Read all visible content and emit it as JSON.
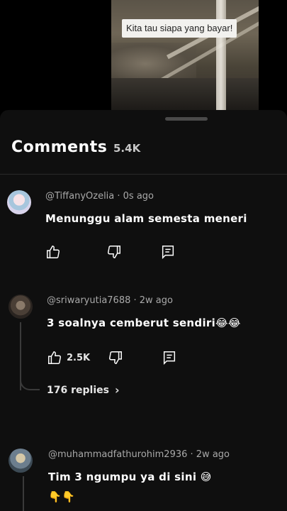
{
  "video": {
    "caption": "Kita tau siapa yang bayar!"
  },
  "sheet": {
    "title": "Comments",
    "count": "5.4K"
  },
  "comments": [
    {
      "author": "@TiffanyOzelia · 0s ago",
      "text": "Menunggu alam semesta meneri",
      "likes": ""
    },
    {
      "author": "@sriwaryutia7688 · 2w ago",
      "text": "3 soalnya cemberut sendiri😂😂",
      "likes": "2.5K",
      "replies": "176 replies"
    },
    {
      "author": "@muhammadfathurohim2936 · 2w ago",
      "text": "Tim 3 ngumpu ya di sini 😅",
      "text2": "👇👇"
    }
  ],
  "icons": {
    "like": "thumbs-up-icon",
    "dislike": "thumbs-down-icon",
    "reply": "reply-icon",
    "replies_chevron": "chevron-right-icon"
  }
}
